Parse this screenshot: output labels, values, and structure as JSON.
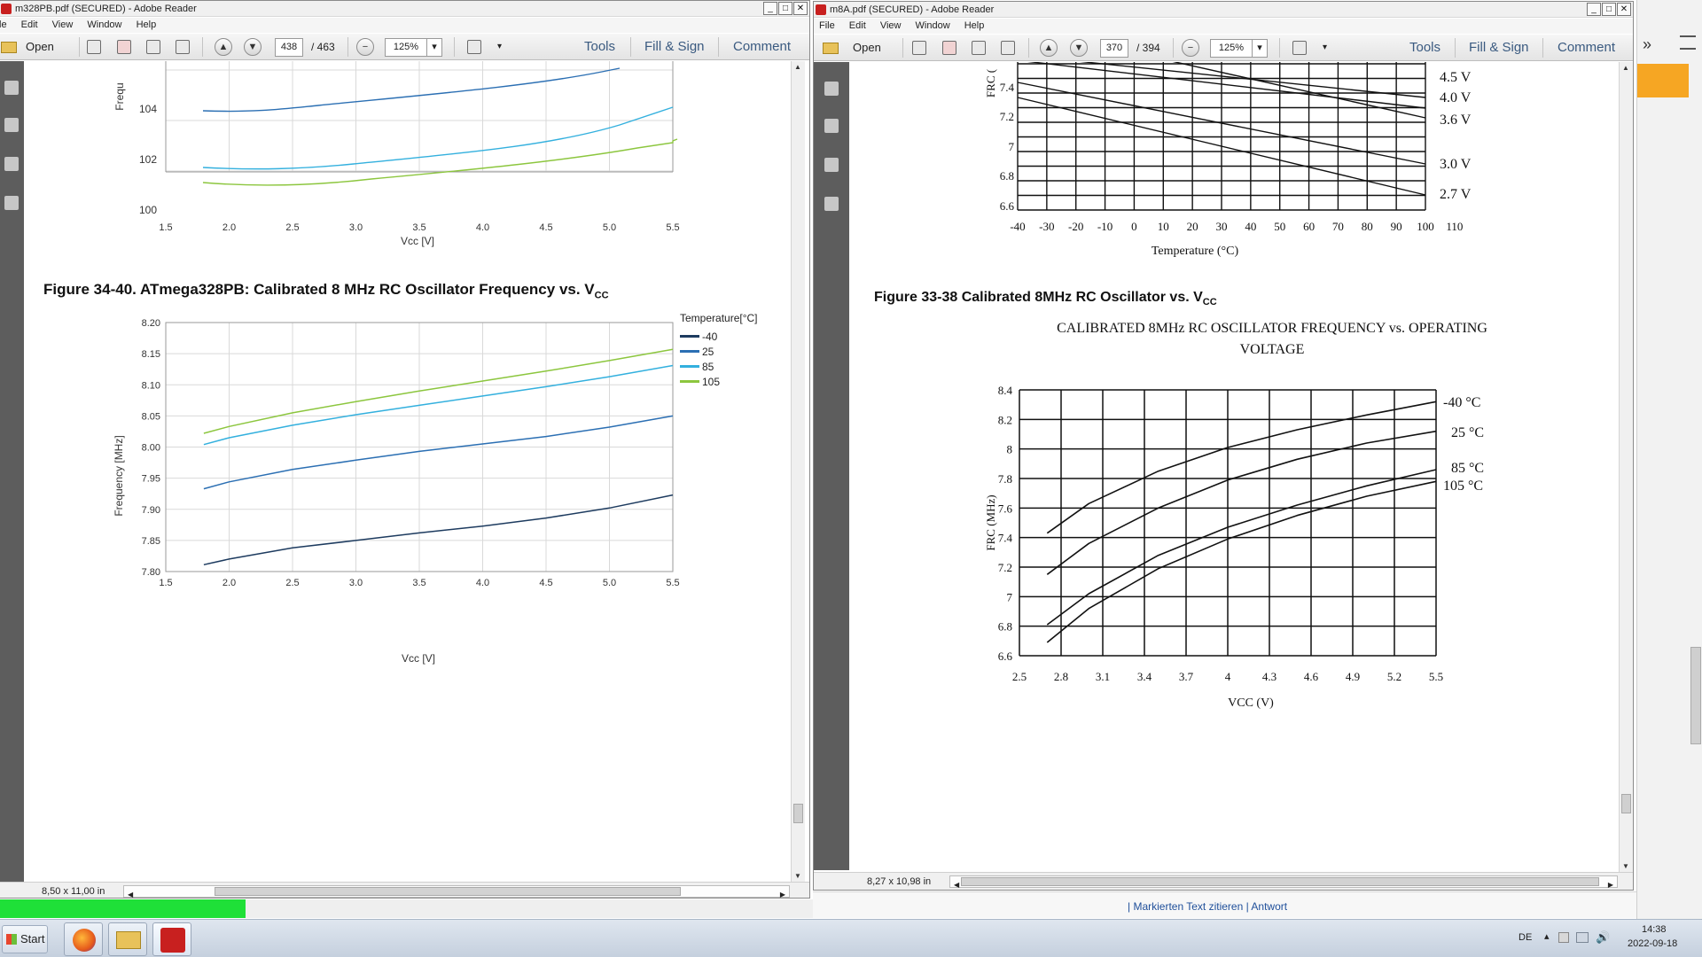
{
  "left_window": {
    "title": "m328PB.pdf (SECURED) - Adobe Reader",
    "menu": [
      "le",
      "Edit",
      "View",
      "Window",
      "Help"
    ],
    "toolbar": {
      "open": "Open",
      "page": "438",
      "total": "/ 463",
      "zoom": "125%",
      "tools": "Tools",
      "fill_sign": "Fill & Sign",
      "comment": "Comment"
    },
    "status_size": "8,50 x 11,00 in",
    "chart_top": {
      "ylabel": "Frequ",
      "yticks": [
        "104",
        "102",
        "100"
      ],
      "xticks": [
        "1.5",
        "2.0",
        "2.5",
        "3.0",
        "3.5",
        "4.0",
        "4.5",
        "5.0",
        "5.5"
      ],
      "xlabel": "Vcc [V]"
    },
    "caption_main": "Figure 34-40.  ATmega328PB: Calibrated 8 MHz RC Oscillator Frequency vs. V",
    "caption_sub": "CC",
    "chart_main": {
      "legend_title": "Temperature[°C]",
      "legend": [
        "-40",
        "25",
        "85",
        "105"
      ],
      "ylabel": "Frequency [MHz]",
      "xlabel": "Vcc [V]",
      "yticks": [
        "8.20",
        "8.15",
        "8.10",
        "8.05",
        "8.00",
        "7.95",
        "7.90",
        "7.85",
        "7.80"
      ],
      "xticks": [
        "1.5",
        "2.0",
        "2.5",
        "3.0",
        "3.5",
        "4.0",
        "4.5",
        "5.0",
        "5.5"
      ]
    }
  },
  "right_window": {
    "title": "m8A.pdf (SECURED) - Adobe Reader",
    "menu": [
      "File",
      "Edit",
      "View",
      "Window",
      "Help"
    ],
    "toolbar": {
      "open": "Open",
      "page": "370",
      "total": "/ 394",
      "zoom": "125%",
      "tools": "Tools",
      "fill_sign": "Fill & Sign",
      "comment": "Comment"
    },
    "status_size": "8,27 x 10,98 in",
    "chart_top": {
      "ylabel": "FRC (",
      "yticks": [
        "7.4",
        "7.2",
        "7",
        "6.8",
        "6.6"
      ],
      "xticks": [
        "-40",
        "-30",
        "-20",
        "-10",
        "0",
        "10",
        "20",
        "30",
        "40",
        "50",
        "60",
        "70",
        "80",
        "90",
        "100",
        "110"
      ],
      "xlabel": "Temperature (°C)",
      "line_labels": [
        "4.5 V",
        "4.0 V",
        "3.6 V",
        "3.0 V",
        "2.7 V"
      ]
    },
    "caption_main": "Figure 33-38  Calibrated 8MHz RC Oscillator vs. V",
    "caption_sub": "CC",
    "chart_main": {
      "title_line1": "CALIBRATED 8MHz RC OSCILLATOR FREQUENCY vs. OPERATING",
      "title_line2": "VOLTAGE",
      "ylabel": "FRC (MHz)",
      "xlabel": "VCC (V)",
      "yticks": [
        "8.4",
        "8.2",
        "8",
        "7.8",
        "7.6",
        "7.4",
        "7.2",
        "7",
        "6.8",
        "6.6"
      ],
      "xticks": [
        "2.5",
        "2.8",
        "3.1",
        "3.4",
        "3.7",
        "4",
        "4.3",
        "4.6",
        "4.9",
        "5.2",
        "5.5"
      ],
      "line_labels": [
        "-40 °C",
        "25 °C",
        "85 °C",
        "105 °C"
      ]
    },
    "comment_bar": "| Markierten Text zitieren  |  Antwort"
  },
  "taskbar": {
    "start": "Start",
    "lang": "DE",
    "time": "14:38",
    "date": "2022-09-18"
  },
  "chart_data": [
    {
      "type": "line",
      "title": "Figure 34-40.  ATmega328PB: Calibrated 8 MHz RC Oscillator Frequency vs. VCC",
      "xlabel": "Vcc [V]",
      "ylabel": "Frequency [MHz]",
      "xlim": [
        1.5,
        5.5
      ],
      "ylim": [
        7.8,
        8.2
      ],
      "x": [
        1.8,
        2.0,
        2.5,
        3.0,
        3.5,
        4.0,
        4.5,
        5.0,
        5.5
      ],
      "series": [
        {
          "name": "-40",
          "color": "#1d3b5f",
          "values": [
            7.811,
            7.82,
            7.838,
            7.85,
            7.862,
            7.873,
            7.886,
            7.902,
            7.923
          ]
        },
        {
          "name": "25",
          "color": "#2b6fb3",
          "values": [
            7.933,
            7.944,
            7.964,
            7.979,
            7.993,
            8.005,
            8.017,
            8.032,
            8.05
          ]
        },
        {
          "name": "85",
          "color": "#33b0de",
          "values": [
            8.004,
            8.015,
            8.035,
            8.052,
            8.067,
            8.082,
            8.097,
            8.113,
            8.131
          ]
        },
        {
          "name": "105",
          "color": "#8cc63e",
          "values": [
            8.022,
            8.033,
            8.055,
            8.073,
            8.09,
            8.106,
            8.122,
            8.139,
            8.157
          ]
        }
      ],
      "legend_title": "Temperature[°C]",
      "legend": "top-right"
    },
    {
      "type": "line",
      "title": "CALIBRATED 8MHz RC OSCILLATOR FREQUENCY vs. OPERATING VOLTAGE",
      "xlabel": "VCC (V)",
      "ylabel": "FRC (MHz)",
      "xlim": [
        2.5,
        5.5
      ],
      "ylim": [
        6.6,
        8.4
      ],
      "x": [
        2.7,
        3.0,
        3.5,
        4.0,
        4.5,
        5.0,
        5.5
      ],
      "series": [
        {
          "name": "-40 °C",
          "values": [
            7.43,
            7.63,
            7.85,
            8.01,
            8.13,
            8.23,
            8.32
          ]
        },
        {
          "name": "25 °C",
          "values": [
            7.15,
            7.36,
            7.6,
            7.79,
            7.93,
            8.04,
            8.12
          ]
        },
        {
          "name": "85 °C",
          "values": [
            6.81,
            7.02,
            7.28,
            7.47,
            7.62,
            7.75,
            7.86
          ]
        },
        {
          "name": "105 °C",
          "values": [
            6.69,
            6.92,
            7.19,
            7.39,
            7.55,
            7.68,
            7.78
          ]
        }
      ],
      "grid": true
    }
  ]
}
